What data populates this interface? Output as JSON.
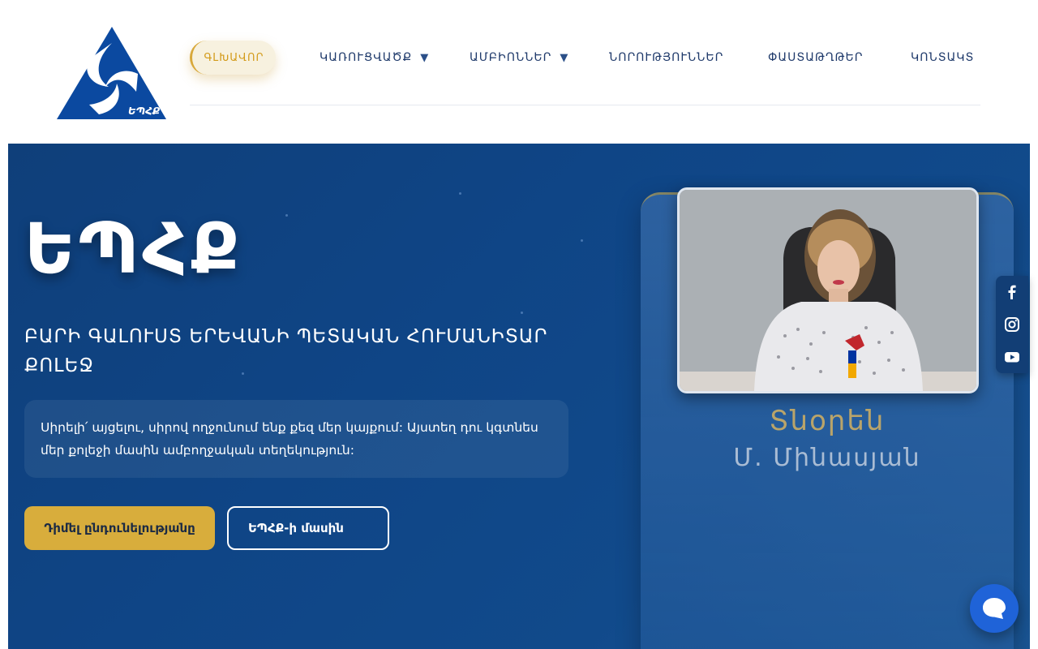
{
  "header": {
    "logo_icon": "triangle-spiral-logo",
    "logo_text": "ԵՊՀՔ",
    "nav": [
      {
        "label": "ԳԼԽԱՎՈՐ",
        "active": true
      },
      {
        "label": "ԿԱՌՈՒՑՎԱԾՔ",
        "dropdown": true
      },
      {
        "label": "ԱՄԲԻՈՆՆԵՐ",
        "dropdown": true
      },
      {
        "label": "ՆՈՐՈՒԹՅՈՒՆՆԵՐ"
      },
      {
        "label": "ՓԱՍՏԱԹՂԹԵՐ"
      },
      {
        "label": "ԿՈՆՏԱԿՏ"
      }
    ],
    "dropdown_arrow": "▼"
  },
  "hero": {
    "title": "ԵՊՀՔ",
    "subtitle": "ԲԱՐԻ ԳԱԼՈՒՍՏ ԵՐԵՎԱՆԻ ՊԵՏԱԿԱՆ ՀՈՒՄԱՆԻՏԱՐ ՔՈԼԵՋ",
    "intro": "Սիրելի՛ այցելու, սիրով ողջունում ենք քեզ մեր կայքում: Այստեղ դու կգտնես մեր քոլեջի մասին ամբողջական տեղեկություն:",
    "apply_button": "Դիմել ընդունելությանը",
    "about_button": "ԵՊՀՔ-ի մասին"
  },
  "director": {
    "role": "Տնօրեն",
    "name": "Մ. Մինասյան"
  },
  "social": [
    "facebook-icon",
    "instagram-icon",
    "youtube-icon"
  ],
  "chat": {
    "icon": "chat-bubble-icon"
  },
  "colors": {
    "primary": "#0f4586",
    "accent_gold": "#d8ad3c",
    "nav_text": "#1f3a6b",
    "logo_blue": "#0b49a0"
  }
}
